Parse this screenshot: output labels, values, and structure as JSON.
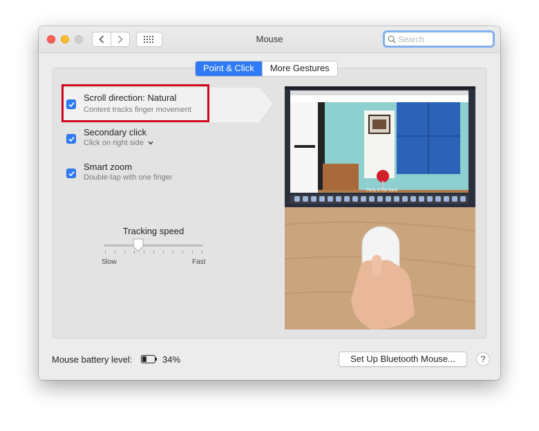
{
  "window": {
    "title": "Mouse"
  },
  "search": {
    "placeholder": "Search"
  },
  "tabs": [
    {
      "label": "Point & Click",
      "active": true
    },
    {
      "label": "More Gestures",
      "active": false
    }
  ],
  "options": [
    {
      "title": "Scroll direction: Natural",
      "subtitle": "Content tracks finger movement",
      "checked": true,
      "highlighted": true
    },
    {
      "title": "Secondary click",
      "subtitle": "Click on right side",
      "checked": true,
      "has_dropdown": true
    },
    {
      "title": "Smart zoom",
      "subtitle": "Double-tap with one finger",
      "checked": true
    }
  ],
  "tracking": {
    "title": "Tracking speed",
    "min_label": "Slow",
    "max_label": "Fast",
    "value": 0.35
  },
  "battery": {
    "label": "Mouse battery level:",
    "percent": "34%"
  },
  "buttons": {
    "bluetooth": "Set Up Bluetooth Mouse...",
    "help": "?"
  },
  "preview": {
    "caption": "Party in the Back"
  },
  "colors": {
    "accent": "#2f7af6",
    "highlight_border": "#d0021b"
  }
}
